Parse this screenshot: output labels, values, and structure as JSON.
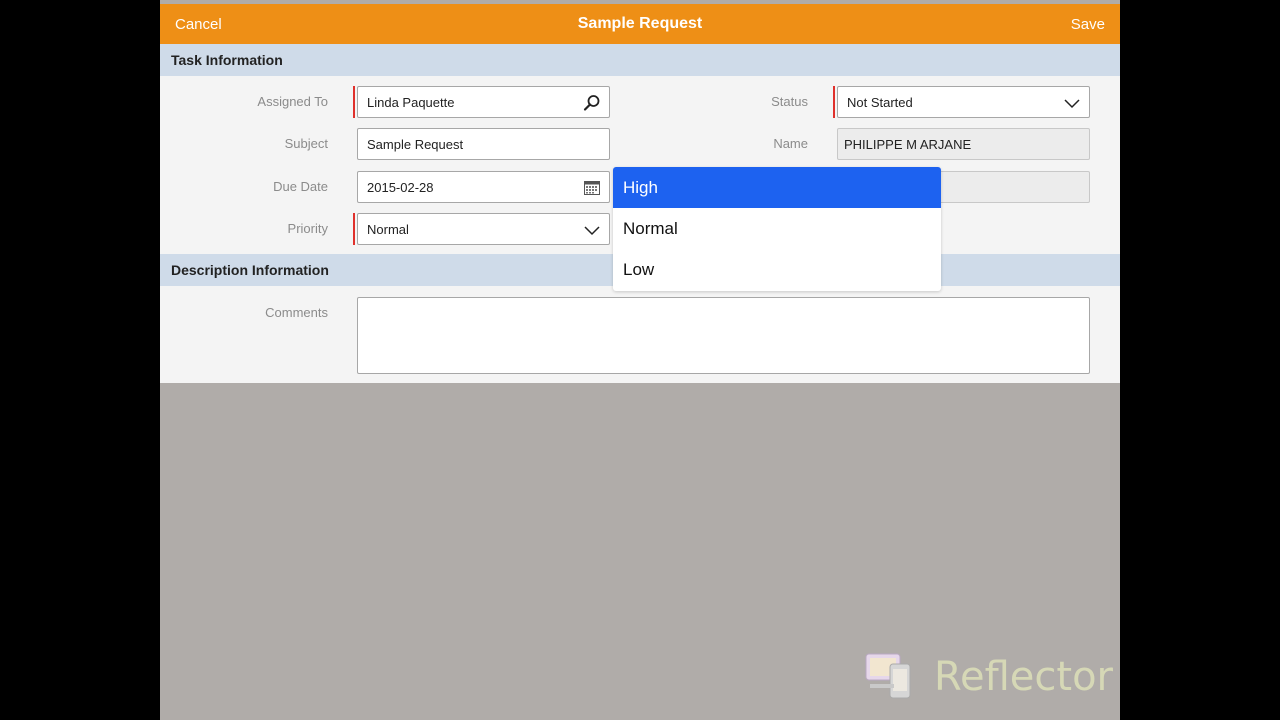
{
  "nav": {
    "cancel": "Cancel",
    "title": "Sample Request",
    "save": "Save"
  },
  "task_section": {
    "title": "Task Information"
  },
  "fields": {
    "assigned_to": {
      "label": "Assigned To",
      "value": "Linda Paquette"
    },
    "subject": {
      "label": "Subject",
      "value": "Sample Request"
    },
    "due_date": {
      "label": "Due Date",
      "value": "2015-02-28"
    },
    "priority": {
      "label": "Priority",
      "value": "Normal"
    },
    "status": {
      "label": "Status",
      "value": "Not Started"
    },
    "name": {
      "label": "Name",
      "value": "PHILIPPE M ARJANE"
    }
  },
  "description_section": {
    "title": "Description Information"
  },
  "comments": {
    "label": "Comments",
    "value": ""
  },
  "priority_options": [
    "High",
    "Normal",
    "Low"
  ],
  "selected_option": "High",
  "watermark": {
    "text": "Reflector"
  },
  "colors": {
    "nav": "#ee8f16",
    "selection": "#1d62f0",
    "required": "#e0312c",
    "section": "#cfdbe9"
  }
}
